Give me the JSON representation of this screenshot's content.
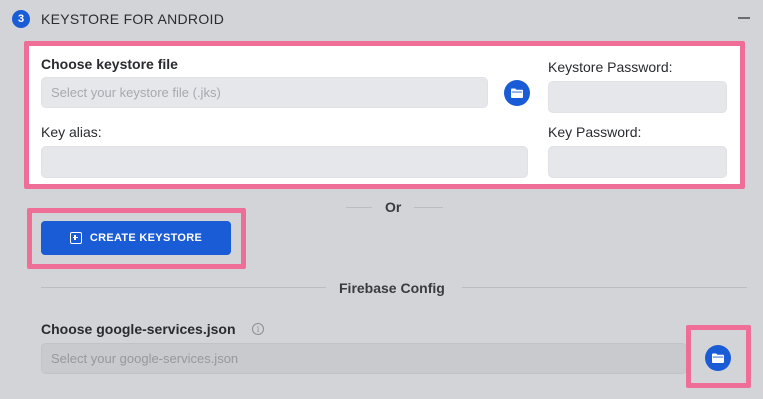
{
  "section": {
    "step_number": "3",
    "title": "KEYSTORE FOR ANDROID"
  },
  "keystore": {
    "file_label": "Choose keystore file",
    "file_placeholder": "Select your keystore file (.jks)",
    "keystore_password_label": "Keystore Password:",
    "key_alias_label": "Key alias:",
    "key_password_label": "Key Password:"
  },
  "or_divider": "Or",
  "create_keystore_label": "CREATE KEYSTORE",
  "firebase": {
    "divider_title": "Firebase Config",
    "google_services_label": "Choose google-services.json",
    "google_services_placeholder": "Select your google-services.json"
  },
  "colors": {
    "accent": "#1a5bd6",
    "highlight": "#ee6e97",
    "background": "#d3d4d7"
  },
  "icons": {
    "folder": "folder-icon",
    "plus_square": "plus-square-icon",
    "info": "info-icon",
    "collapse": "minus-icon"
  }
}
